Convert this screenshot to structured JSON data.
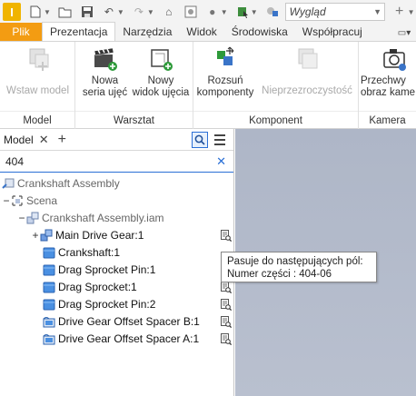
{
  "qat": {
    "app_letter": "I",
    "appearance_value": "Wygląd"
  },
  "tabs": [
    {
      "label": "Plik"
    },
    {
      "label": "Prezentacja"
    },
    {
      "label": "Narzędzia"
    },
    {
      "label": "Widok"
    },
    {
      "label": "Środowiska"
    },
    {
      "label": "Współpracuj"
    }
  ],
  "ribbon": {
    "model_panel": {
      "title": "Model",
      "insert_model": "Wstaw model"
    },
    "workshop_panel": {
      "title": "Warsztat",
      "new_storyboard_1": "Nowa",
      "new_storyboard_2": "seria ujęć",
      "new_snapshot_1": "Nowy",
      "new_snapshot_2": "widok ujęcia"
    },
    "component_panel": {
      "title": "Komponent",
      "tweak_1": "Rozsuń",
      "tweak_2": "komponenty",
      "opacity": "Nieprzezroczystość"
    },
    "camera_panel": {
      "title": "Kamera",
      "capture_1": "Przechwy",
      "capture_2": "obraz kame"
    }
  },
  "browser": {
    "title": "Model",
    "search_value": "404",
    "tree": [
      {
        "label": "Crankshaft Assembly"
      },
      {
        "label": "Scena"
      },
      {
        "label": "Crankshaft Assembly.iam"
      },
      {
        "label": "Main Drive Gear:1"
      },
      {
        "label": "Crankshaft:1"
      },
      {
        "label": "Drag Sprocket Pin:1"
      },
      {
        "label": "Drag Sprocket:1"
      },
      {
        "label": "Drag Sprocket Pin:2"
      },
      {
        "label": "Drive Gear Offset Spacer B:1"
      },
      {
        "label": "Drive Gear Offset Spacer A:1"
      }
    ]
  },
  "tooltip": {
    "line1": "Pasuje do następujących pól:",
    "line2": "Numer części : 404-06"
  },
  "colors": {
    "file_tab": "#f39c12",
    "accent_blue": "#2a6fd6",
    "viewport": "#b4bccb"
  }
}
